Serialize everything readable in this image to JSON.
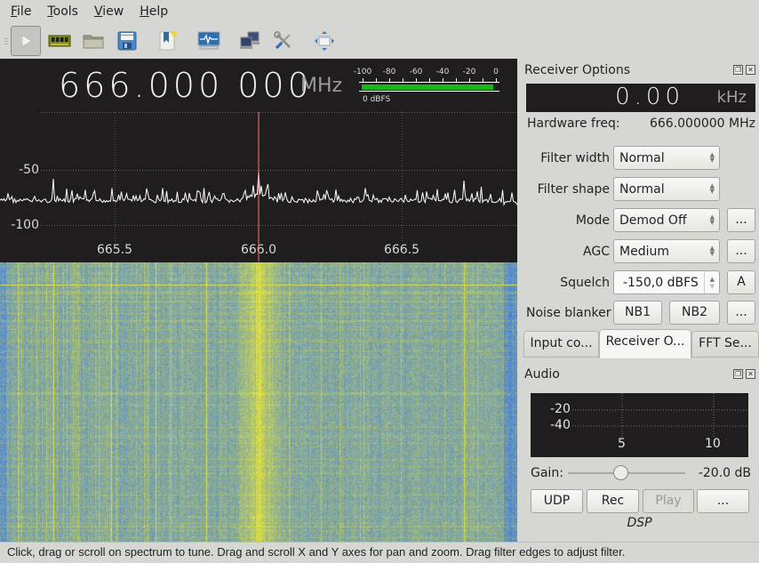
{
  "menubar": {
    "items": [
      {
        "label": "File",
        "mnemonic": "F",
        "rest": "ile"
      },
      {
        "label": "Tools",
        "mnemonic": "T",
        "rest": "ools"
      },
      {
        "label": "View",
        "mnemonic": "V",
        "rest": "iew"
      },
      {
        "label": "Help",
        "mnemonic": "H",
        "rest": "elp"
      }
    ]
  },
  "toolbar": {
    "buttons": [
      {
        "name": "start-dsp",
        "icon": "play-icon",
        "pressed": true
      },
      {
        "name": "configure-device",
        "icon": "hardware-card-icon"
      },
      {
        "name": "load-settings",
        "icon": "folder-icon"
      },
      {
        "name": "save-settings",
        "icon": "floppy-disk-icon"
      },
      {
        "name": "new-bookmark",
        "icon": "bookmark-icon"
      },
      {
        "name": "spectrum-analyzer",
        "icon": "monitor-waveform-icon"
      },
      {
        "name": "remote-control",
        "icon": "network-computers-icon"
      },
      {
        "name": "preferences",
        "icon": "wrench-screwdriver-icon"
      },
      {
        "name": "fullscreen",
        "icon": "fullscreen-arrows-icon"
      }
    ]
  },
  "frequency": {
    "digits": "666.000 000",
    "unit": "MHz"
  },
  "signal_meter": {
    "ticks": [
      "-100",
      "-80",
      "-60",
      "-40",
      "-20",
      "0"
    ],
    "level_dbfs": 0,
    "readout": "0 dBFS",
    "bar_color": "#16b716"
  },
  "spectrum": {
    "y_labels": [
      "-50",
      "-100"
    ],
    "x_labels": [
      "665.5",
      "666.0",
      "666.5"
    ],
    "center_marker_color": "#ff6a6a",
    "trace_color": "#ffffff"
  },
  "waterfall": {
    "low_color": "#3a79e6",
    "high_color": "#e6e63a"
  },
  "receiver_options": {
    "title": "Receiver Options",
    "offset_value": "0.00",
    "offset_unit": "kHz",
    "hardware_freq_label": "Hardware freq:",
    "hardware_freq_value": "666.000000 MHz",
    "filter_width_label": "Filter width",
    "filter_width_value": "Normal",
    "filter_shape_label": "Filter shape",
    "filter_shape_value": "Normal",
    "mode_label": "Mode",
    "mode_value": "Demod Off",
    "agc_label": "AGC",
    "agc_value": "Medium",
    "squelch_label": "Squelch",
    "squelch_value": "-150,0 dBFS",
    "squelch_auto_label": "A",
    "noise_blanker_label": "Noise blanker",
    "nb1_label": "NB1",
    "nb2_label": "NB2",
    "more_label": "..."
  },
  "dock_tabs": [
    {
      "label": "Input co...",
      "active": false
    },
    {
      "label": "Receiver O...",
      "active": true
    },
    {
      "label": "FFT Se...",
      "active": false
    }
  ],
  "audio": {
    "title": "Audio",
    "fft_y_labels": [
      "-20",
      "-40"
    ],
    "fft_x_labels": [
      "5",
      "10"
    ],
    "gain_label": "Gain:",
    "gain_value": "-20.0 dB",
    "gain_slider_fraction": 0.45,
    "udp_label": "UDP",
    "rec_label": "Rec",
    "play_label": "Play",
    "more_label": "...",
    "dsp_label": "DSP"
  },
  "status_bar": {
    "text": "Click, drag or scroll on spectrum to tune. Drag and scroll X and Y axes for pan and zoom. Drag filter edges to adjust filter."
  }
}
